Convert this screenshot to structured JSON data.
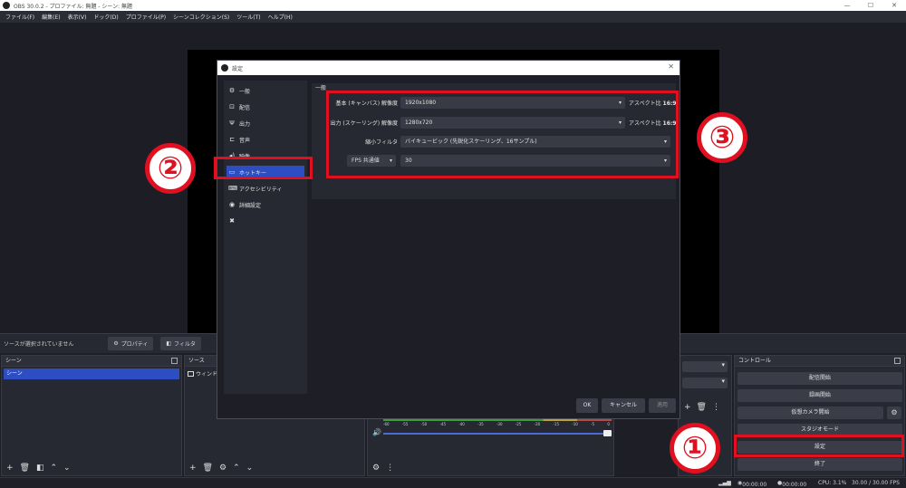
{
  "window": {
    "title": "OBS 30.0.2 - プロファイル: 無題 - シーン: 無題",
    "controls": [
      "—",
      "☐",
      "✕"
    ]
  },
  "menu": [
    "ファイル(F)",
    "編集(E)",
    "表示(V)",
    "ドック(D)",
    "プロファイル(P)",
    "シーンコレクション(S)",
    "ツール(T)",
    "ヘルプ(H)"
  ],
  "source_toolbar": {
    "no_selection": "ソースが選択されていません",
    "properties": "プロパティ",
    "filters": "フィルタ"
  },
  "docks": {
    "scenes": {
      "title": "シーン",
      "items": [
        "シーン"
      ]
    },
    "sources": {
      "title": "ソース",
      "items": [
        "ウィンドウ"
      ]
    },
    "controls": {
      "title": "コントロール",
      "buttons": [
        "配信開始",
        "録画開始",
        "仮想カメラ開始",
        "スタジオモード",
        "設定",
        "終了"
      ]
    },
    "mixer": {
      "ticks": [
        "-60",
        "-55",
        "-50",
        "-45",
        "-40",
        "-35",
        "-30",
        "-25",
        "-20",
        "-15",
        "-10",
        "-5",
        "0"
      ]
    }
  },
  "statusbar": {
    "time1": "00:00:00",
    "time2": "00:00:00",
    "cpu": "CPU: 3.1%",
    "fps": "30.00 / 30.00 FPS"
  },
  "dialog": {
    "title": "設定",
    "nav": [
      {
        "label": "一般",
        "icon": "gear-icon"
      },
      {
        "label": "配信",
        "icon": "stream-icon"
      },
      {
        "label": "出力",
        "icon": "antenna-icon"
      },
      {
        "label": "音声",
        "icon": "output-icon"
      },
      {
        "label": "映像",
        "icon": "speaker-icon"
      },
      {
        "label": "ホットキー",
        "icon": "monitor-icon"
      },
      {
        "label": "アクセシビリティ",
        "icon": "keyboard-icon"
      },
      {
        "label": "詳細設定",
        "icon": "accessibility-icon"
      }
    ],
    "active_nav": "映像",
    "section": "一般",
    "base_resolution_label": "基本 (キャンバス) 解像度",
    "base_resolution_value": "1920x1080",
    "output_resolution_label": "出力 (スケーリング) 解像度",
    "output_resolution_value": "1280x720",
    "aspect_prefix": "アスペクト比",
    "aspect_value": "16:9",
    "downscale_label": "縮小フィルタ",
    "downscale_value": "バイキュービック (先鋭化スケーリング、16サンプル)",
    "fps_type": "FPS 共通値",
    "fps_value": "30",
    "ok": "OK",
    "cancel": "キャンセル",
    "apply": "適用"
  },
  "annotations": {
    "one": "①",
    "two": "②",
    "three": "③"
  },
  "colors": {
    "accent": "#2c4ec2",
    "highlight": "#e01020"
  }
}
